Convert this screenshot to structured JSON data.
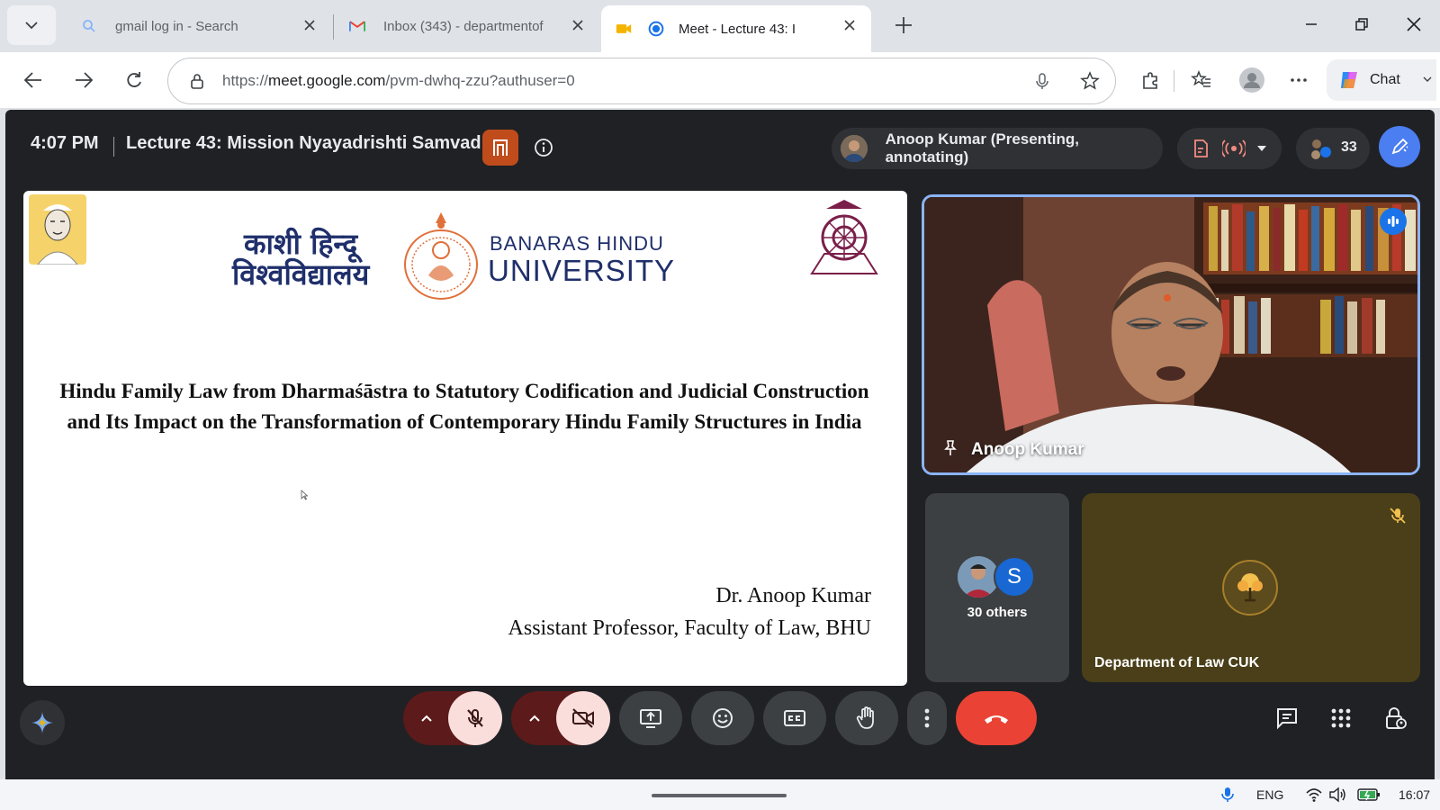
{
  "browser": {
    "tabs": [
      {
        "label": "gmail log in - Search",
        "icon": "search-icon"
      },
      {
        "label": "Inbox (343) - departmentof",
        "icon": "gmail-icon"
      },
      {
        "label": "Meet - Lecture 43: I",
        "icon": "meet-icon",
        "active": true
      }
    ],
    "url_prefix": "https://",
    "url_domain": "meet.google.com",
    "url_path": "/pvm-dwhq-zzu?authuser=0",
    "chat_label": "Chat"
  },
  "meet": {
    "time": "4:07 PM",
    "meeting_title": "Lecture 43: Mission Nyayadrishti Samvad",
    "presenter_chip": "Anoop Kumar (Presenting, annotating)",
    "participant_count": "33",
    "slide": {
      "hindi_line1": "काशी हिन्दू",
      "hindi_line2": "विश्वविद्यालय",
      "eng_line1": "BANARAS HINDU",
      "eng_line2": "UNIVERSITY",
      "title": "Hindu Family Law from Dharmaśāstra to Statutory Codification and Judicial Construction and Its Impact on the Transformation of Contemporary Hindu Family Structures in India",
      "author": "Dr. Anoop Kumar",
      "designation": "Assistant Professor, Faculty of Law, BHU"
    },
    "tiles": {
      "main_name": "Anoop Kumar",
      "others_label": "30 others",
      "others_avatar_letter": "S",
      "dept_name": "Department of Law CUK"
    }
  },
  "taskbar": {
    "language": "ENG",
    "clock": "16:07"
  },
  "colors": {
    "meet_bg": "#202124",
    "accent_blue": "#1a73e8",
    "hangup_red": "#ea4335",
    "bhu_navy": "#1f2f6b",
    "bhu_orange": "#e0703a"
  }
}
